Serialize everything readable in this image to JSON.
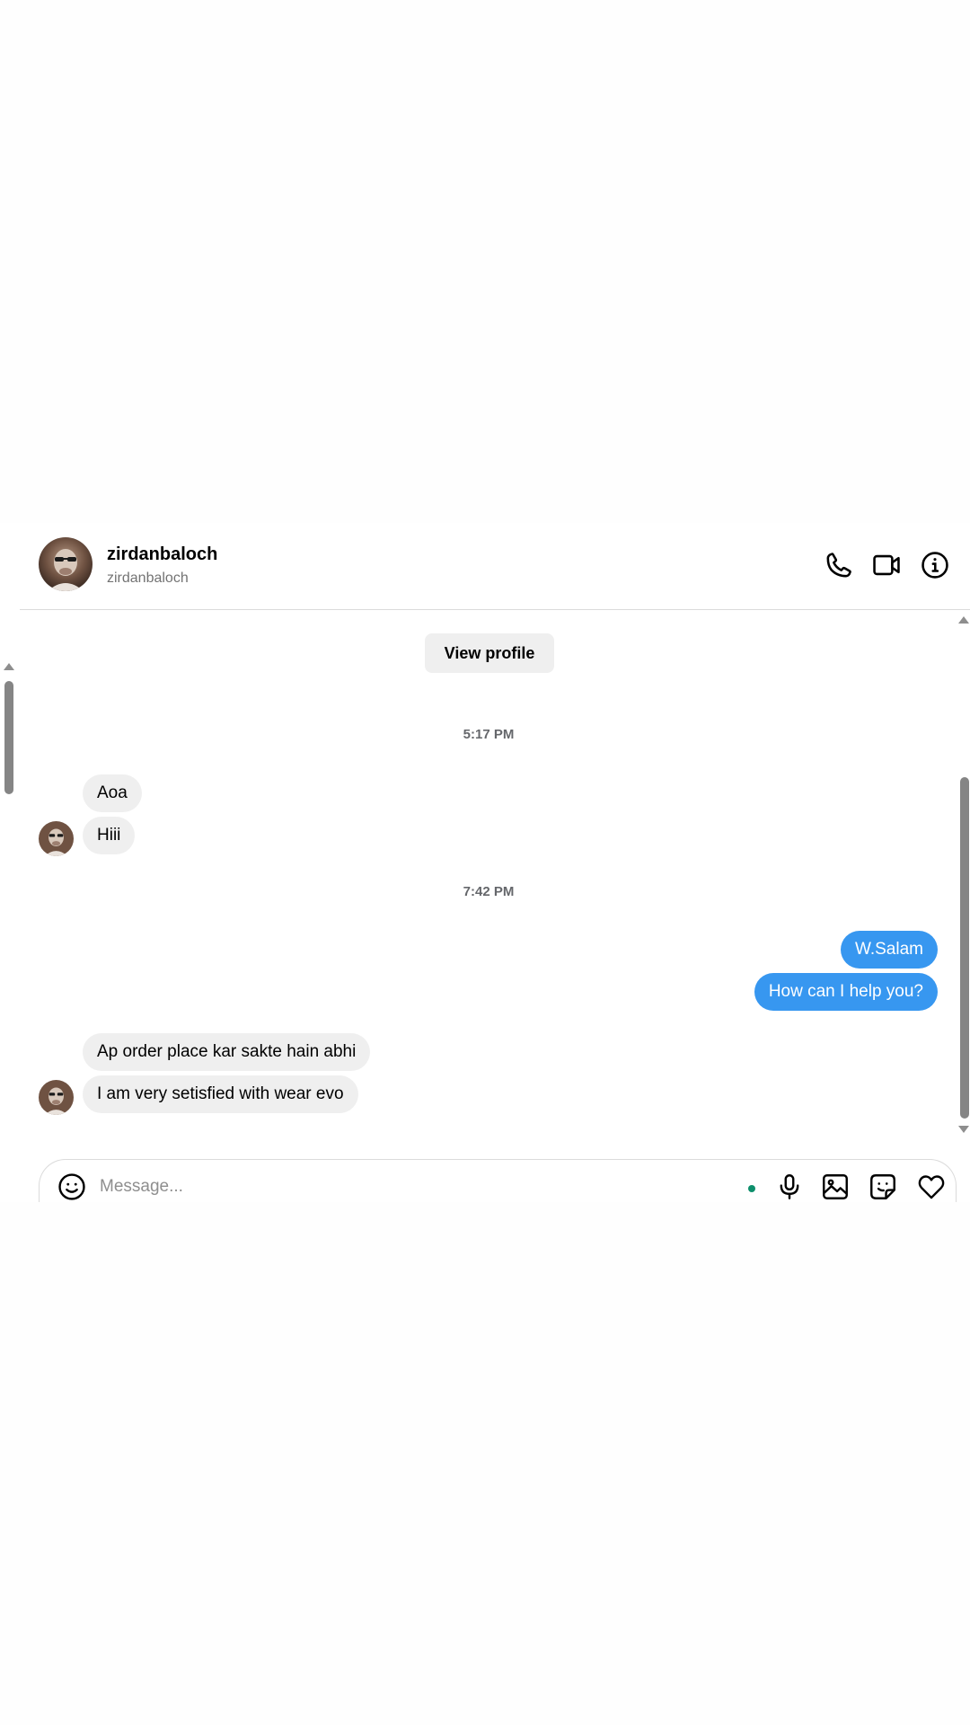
{
  "header": {
    "username": "zirdanbaloch",
    "handle": "zirdanbaloch",
    "actions": [
      {
        "icon": "phone-icon"
      },
      {
        "icon": "video-icon"
      },
      {
        "icon": "info-icon"
      }
    ]
  },
  "thread": {
    "view_profile_label": "View profile",
    "groups": [
      {
        "timestamp": "5:17 PM",
        "messages": [
          {
            "direction": "incoming",
            "text": "Aoa"
          },
          {
            "direction": "incoming",
            "text": "Hiii"
          }
        ]
      },
      {
        "timestamp": "7:42 PM",
        "messages": [
          {
            "direction": "outgoing",
            "text": "W.Salam"
          },
          {
            "direction": "outgoing",
            "text": "How can I help you?"
          },
          {
            "direction": "incoming",
            "text": "Ap order place kar sakte hain abhi"
          },
          {
            "direction": "incoming",
            "text": "I am very setisfied with wear evo"
          }
        ]
      }
    ]
  },
  "composer": {
    "placeholder": "Message...",
    "value": "",
    "icons": [
      "emoji-icon",
      "microphone-icon",
      "image-icon",
      "sticker-icon",
      "heart-icon"
    ]
  },
  "colors": {
    "outgoing_bubble": "#3797f0",
    "incoming_bubble": "#efefef",
    "status_dot": "#0d8f6c"
  }
}
